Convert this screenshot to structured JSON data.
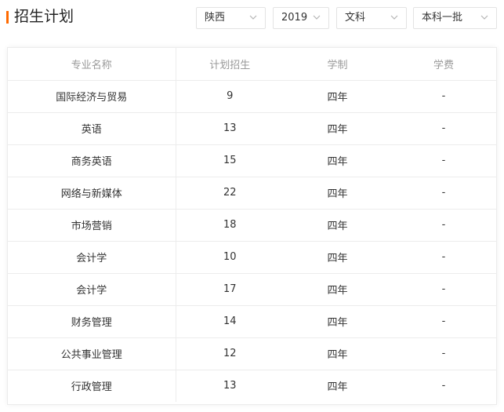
{
  "page": {
    "title": "招生计划",
    "accent_color": "#ff6a00"
  },
  "filters": {
    "province": "陕西",
    "year": "2019",
    "subject": "文科",
    "batch": "本科一批"
  },
  "table": {
    "columns": [
      "专业名称",
      "计划招生",
      "学制",
      "学费"
    ],
    "rows": [
      {
        "major": "国际经济与贸易",
        "plan": "9",
        "duration": "四年",
        "fee": "-"
      },
      {
        "major": "英语",
        "plan": "13",
        "duration": "四年",
        "fee": "-"
      },
      {
        "major": "商务英语",
        "plan": "15",
        "duration": "四年",
        "fee": "-"
      },
      {
        "major": "网络与新媒体",
        "plan": "22",
        "duration": "四年",
        "fee": "-"
      },
      {
        "major": "市场营销",
        "plan": "18",
        "duration": "四年",
        "fee": "-"
      },
      {
        "major": "会计学",
        "plan": "10",
        "duration": "四年",
        "fee": "-"
      },
      {
        "major": "会计学",
        "plan": "17",
        "duration": "四年",
        "fee": "-"
      },
      {
        "major": "财务管理",
        "plan": "14",
        "duration": "四年",
        "fee": "-"
      },
      {
        "major": "公共事业管理",
        "plan": "12",
        "duration": "四年",
        "fee": "-"
      },
      {
        "major": "行政管理",
        "plan": "13",
        "duration": "四年",
        "fee": "-"
      }
    ]
  }
}
